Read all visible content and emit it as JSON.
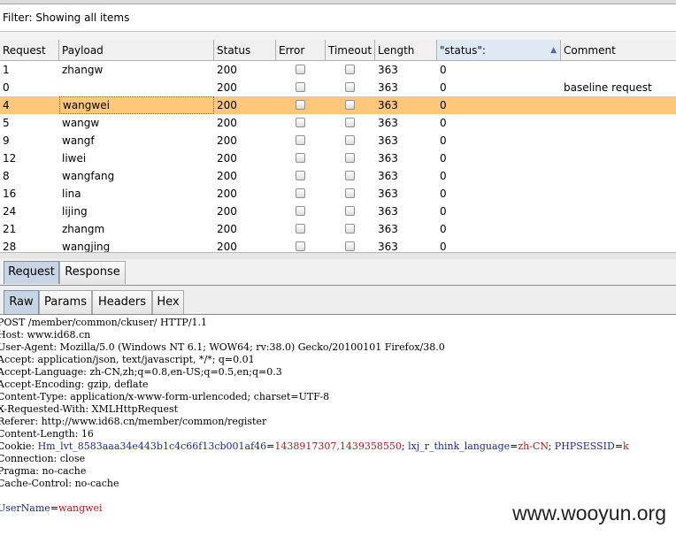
{
  "filter": {
    "text": "Filter: Showing all items"
  },
  "columns": [
    "Request",
    "Payload",
    "Status",
    "Error",
    "Timeout",
    "Length",
    "\"status\":",
    "Comment"
  ],
  "sort": {
    "column": "\"status\":",
    "direction": "ascending"
  },
  "rows": [
    {
      "request": "1",
      "payload": "zhangw",
      "status": "200",
      "error": false,
      "timeout": false,
      "length": "363",
      "grep": "0",
      "comment": ""
    },
    {
      "request": "0",
      "payload": "",
      "status": "200",
      "error": false,
      "timeout": false,
      "length": "363",
      "grep": "0",
      "comment": "baseline request"
    },
    {
      "request": "4",
      "payload": "wangwei",
      "status": "200",
      "error": false,
      "timeout": false,
      "length": "363",
      "grep": "0",
      "comment": "",
      "selected": true
    },
    {
      "request": "5",
      "payload": "wangw",
      "status": "200",
      "error": false,
      "timeout": false,
      "length": "363",
      "grep": "0",
      "comment": ""
    },
    {
      "request": "9",
      "payload": "wangf",
      "status": "200",
      "error": false,
      "timeout": false,
      "length": "363",
      "grep": "0",
      "comment": ""
    },
    {
      "request": "12",
      "payload": "liwei",
      "status": "200",
      "error": false,
      "timeout": false,
      "length": "363",
      "grep": "0",
      "comment": ""
    },
    {
      "request": "8",
      "payload": "wangfang",
      "status": "200",
      "error": false,
      "timeout": false,
      "length": "363",
      "grep": "0",
      "comment": ""
    },
    {
      "request": "16",
      "payload": "lina",
      "status": "200",
      "error": false,
      "timeout": false,
      "length": "363",
      "grep": "0",
      "comment": ""
    },
    {
      "request": "24",
      "payload": "lijing",
      "status": "200",
      "error": false,
      "timeout": false,
      "length": "363",
      "grep": "0",
      "comment": ""
    },
    {
      "request": "21",
      "payload": "zhangm",
      "status": "200",
      "error": false,
      "timeout": false,
      "length": "363",
      "grep": "0",
      "comment": ""
    },
    {
      "request": "28",
      "payload": "wangjing",
      "status": "200",
      "error": false,
      "timeout": false,
      "length": "363",
      "grep": "0",
      "comment": ""
    }
  ],
  "detail_tabs": {
    "request": "Request",
    "response": "Response",
    "active": "Request"
  },
  "view_tabs": {
    "raw": "Raw",
    "params": "Params",
    "headers": "Headers",
    "hex": "Hex",
    "active": "Raw"
  },
  "request_lines": [
    "POST /member/common/ckuser/ HTTP/1.1",
    "Host: www.id68.cn",
    "User-Agent: Mozilla/5.0 (Windows NT 6.1; WOW64; rv:38.0) Gecko/20100101 Firefox/38.0",
    "Accept: application/json, text/javascript, */*; q=0.01",
    "Accept-Language: zh-CN,zh;q=0.8,en-US;q=0.5,en;q=0.3",
    "Accept-Encoding: gzip, deflate",
    "Content-Type: application/x-www-form-urlencoded; charset=UTF-8",
    "X-Requested-With: XMLHttpRequest",
    "Referer: http://www.id68.cn/member/common/register",
    "Content-Length: 16"
  ],
  "cookie": {
    "label": "Cookie: ",
    "k1": "Hm_lvt_8583aaa34e443b1c4c66f13cb001af46",
    "v1": "1438917307,1439358550",
    "k2": "lxj_r_think_language",
    "v2": "zh-CN",
    "k3": "PHPSESSID",
    "v3": "k"
  },
  "request_lines_after": [
    "Connection: close",
    "Pragma: no-cache",
    "Cache-Control: no-cache"
  ],
  "body_param": {
    "name": "UserName",
    "value": "wangwei"
  },
  "watermark": "www.wooyun.org",
  "colors": {
    "selected_row": "#ffc77a",
    "active_tab": "#c6d4e4",
    "param_name": "#1e2a8a",
    "param_value": "#a01e1e"
  }
}
